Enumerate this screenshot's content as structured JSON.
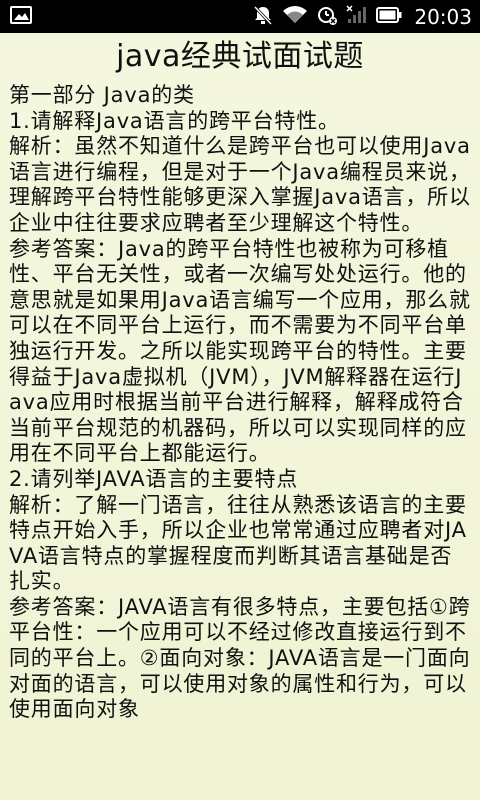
{
  "status_bar": {
    "time": "20:03",
    "icons": [
      "image-icon",
      "mute-icon",
      "wifi-icon",
      "alarm-icon",
      "signal-icon",
      "battery-icon"
    ]
  },
  "page": {
    "title": "java经典试面试题",
    "paragraphs": [
      "第一部分 Java的类",
      "1.请解释Java语言的跨平台特性。",
      "解析：虽然不知道什么是跨平台也可以使用Java语言进行编程，但是对于一个Java编程员来说，理解跨平台特性能够更深入掌握Java语言，所以企业中往往要求应聘者至少理解这个特性。",
      "参考答案：Java的跨平台特性也被称为可移植性、平台无关性，或者一次编写处处运行。他的意思就是如果用Java语言编写一个应用，那么就可以在不同平台上运行，而不需要为不同平台单独运行开发。之所以能实现跨平台的特性。主要得益于Java虚拟机（JVM），JVM解释器在运行Java应用时根据当前平台进行解释，解释成符合当前平台规范的机器码，所以可以实现同样的应用在不同平台上都能运行。",
      "2.请列举JAVA语言的主要特点",
      "解析：了解一门语言，往往从熟悉该语言的主要特点开始入手，所以企业也常常通过应聘者对JAVA语言特点的掌握程度而判断其语言基础是否扎实。",
      "参考答案：JAVA语言有很多特点，主要包括①跨平台性：一个应用可以不经过修改直接运行到不同的平台上。②面向对象：JAVA语言是一门面向对面的语言，可以使用对象的属性和行为，可以使用面向对象"
    ]
  },
  "colors": {
    "status_bar_bg": "#000000",
    "page_bg": "#f3f6dc",
    "text": "#111111"
  }
}
